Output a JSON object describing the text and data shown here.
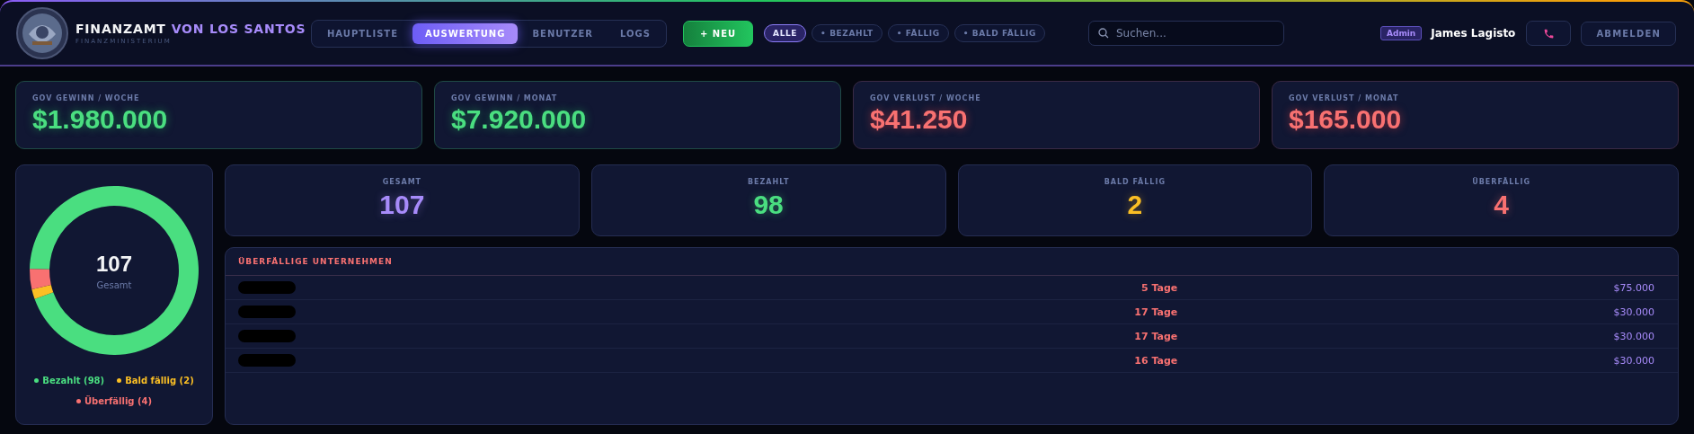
{
  "header": {
    "title": "FINANZAMT",
    "title_accent": "VON LOS SANTOS",
    "subtitle": "FINANZMINISTERIUM",
    "tabs": [
      {
        "label": "HAUPTLISTE",
        "selected": false
      },
      {
        "label": "AUSWERTUNG",
        "selected": true
      },
      {
        "label": "BENUTZER",
        "selected": false
      },
      {
        "label": "LOGS",
        "selected": false
      }
    ],
    "new_button": "+ NEU",
    "filters": [
      {
        "label": "ALLE",
        "selected": true
      },
      {
        "label": "• BEZAHLT",
        "selected": false
      },
      {
        "label": "• FÄLLIG",
        "selected": false
      },
      {
        "label": "• BALD FÄLLIG",
        "selected": false
      }
    ],
    "search": {
      "placeholder": "Suchen..."
    },
    "role_badge": "Admin",
    "user_name": "James Lagisto",
    "logout_button": "ABMELDEN"
  },
  "kpis": [
    {
      "label": "GOV GEWINN / WOCHE",
      "value": "$1.980.000",
      "kind": "gain"
    },
    {
      "label": "GOV GEWINN / MONAT",
      "value": "$7.920.000",
      "kind": "gain"
    },
    {
      "label": "GOV VERLUST / WOCHE",
      "value": "$41.250",
      "kind": "loss"
    },
    {
      "label": "GOV VERLUST / MONAT",
      "value": "$165.000",
      "kind": "loss"
    }
  ],
  "donut": {
    "center_value": "107",
    "center_label": "Gesamt",
    "chart_data": {
      "type": "donut",
      "categories": [
        "Bezahlt (98)",
        "Bald fällig (2)",
        "Überfällig (4)"
      ],
      "values": [
        98,
        2,
        4
      ]
    },
    "legend": [
      {
        "color": "#4ade80"
      },
      {
        "color": "#fbbf24"
      },
      {
        "color": "#f87171"
      }
    ]
  },
  "stats": [
    {
      "label": "GESAMT",
      "value": "107",
      "color": "#a78bfa"
    },
    {
      "label": "BEZAHLT",
      "value": "98",
      "color": "#4ade80"
    },
    {
      "label": "BALD FÄLLIG",
      "value": "2",
      "color": "#fbbf24"
    },
    {
      "label": "ÜBERFÄLLIG",
      "value": "4",
      "color": "#f87171"
    }
  ],
  "overdue_table": {
    "title": "ÜBERFÄLLIGE UNTERNEHMEN",
    "rows": [
      {
        "name_redacted": true,
        "days": "5 Tage",
        "amount": "$75.000"
      },
      {
        "name_redacted": true,
        "days": "17 Tage",
        "amount": "$30.000"
      },
      {
        "name_redacted": true,
        "days": "17 Tage",
        "amount": "$30.000"
      },
      {
        "name_redacted": true,
        "days": "16 Tage",
        "amount": "$30.000"
      }
    ]
  }
}
